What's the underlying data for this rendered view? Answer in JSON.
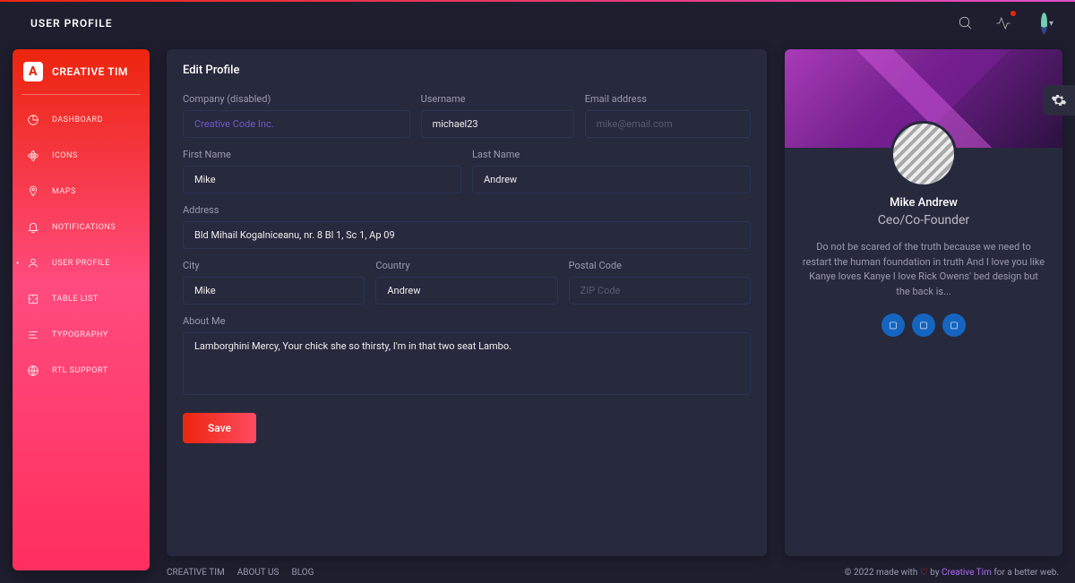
{
  "header": {
    "title": "USER PROFILE"
  },
  "sidebar": {
    "brand": "CREATIVE TIM",
    "items": [
      {
        "label": "DASHBOARD",
        "icon": "chart-pie",
        "active": false
      },
      {
        "label": "ICONS",
        "icon": "atom",
        "active": false
      },
      {
        "label": "MAPS",
        "icon": "pin",
        "active": false
      },
      {
        "label": "NOTIFICATIONS",
        "icon": "bell",
        "active": false
      },
      {
        "label": "USER PROFILE",
        "icon": "user",
        "active": true
      },
      {
        "label": "TABLE LIST",
        "icon": "puzzle",
        "active": false
      },
      {
        "label": "TYPOGRAPHY",
        "icon": "align",
        "active": false
      },
      {
        "label": "RTL SUPPORT",
        "icon": "globe",
        "active": false
      }
    ]
  },
  "form": {
    "title": "Edit Profile",
    "labels": {
      "company": "Company (disabled)",
      "username": "Username",
      "email": "Email address",
      "first_name": "First Name",
      "last_name": "Last Name",
      "address": "Address",
      "city": "City",
      "country": "Country",
      "postal": "Postal Code",
      "about": "About Me"
    },
    "values": {
      "company": "Creative Code Inc.",
      "username": "michael23",
      "email": "",
      "first_name": "Mike",
      "last_name": "Andrew",
      "address": "Bld Mihail Kogalniceanu, nr. 8 Bl 1, Sc 1, Ap 09",
      "city": "Mike",
      "country": "Andrew",
      "postal": "",
      "about": "Lamborghini Mercy, Your chick she so thirsty, I'm in that two seat Lambo."
    },
    "placeholders": {
      "email": "mike@email.com",
      "postal": "ZIP Code"
    },
    "save_label": "Save"
  },
  "profile": {
    "name": "Mike Andrew",
    "title": "Ceo/Co-Founder",
    "bio": "Do not be scared of the truth because we need to restart the human foundation in truth And I love you like Kanye loves Kanye I love Rick Owens' bed design but the back is...",
    "socials": [
      "facebook",
      "twitter",
      "google"
    ]
  },
  "footer": {
    "links": [
      "CREATIVE TIM",
      "ABOUT US",
      "BLOG"
    ],
    "copyright_pre": "© 2022 made with ",
    "copyright_mid": " by ",
    "ct": "Creative Tim",
    "copyright_post": " for a better web."
  }
}
